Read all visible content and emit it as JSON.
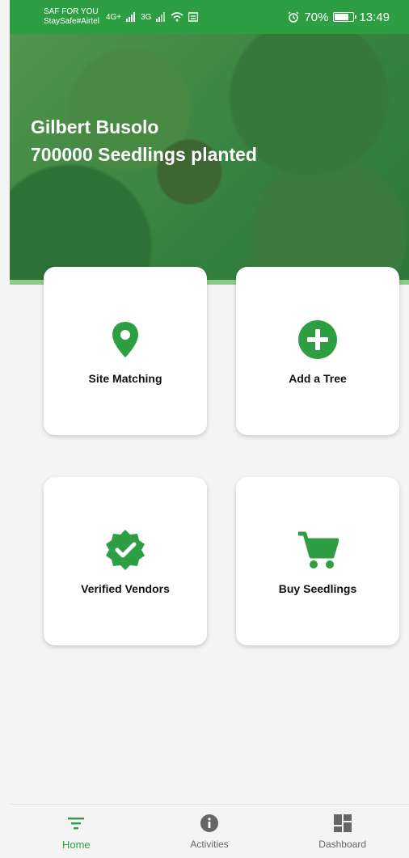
{
  "statusbar": {
    "carrier_line1": "SAF FOR YOU",
    "carrier_line2": "StaySafe#Airtel",
    "net1": "4G+",
    "net2": "3G",
    "battery": "70%",
    "time": "13:49"
  },
  "hero": {
    "name": "Gilbert Busolo",
    "stat": "700000 Seedlings planted"
  },
  "cards": [
    {
      "label": "Site Matching",
      "icon": "location-pin-icon"
    },
    {
      "label": "Add a Tree",
      "icon": "plus-circle-icon"
    },
    {
      "label": "Verified Vendors",
      "icon": "verified-badge-icon"
    },
    {
      "label": "Buy Seedlings",
      "icon": "shopping-cart-icon"
    }
  ],
  "nav": [
    {
      "label": "Home",
      "icon": "filter-lines-icon",
      "active": true
    },
    {
      "label": "Activities",
      "icon": "info-icon",
      "active": false
    },
    {
      "label": "Dashboard",
      "icon": "dashboard-grid-icon",
      "active": false
    }
  ],
  "colors": {
    "accent": "#2e9e43"
  }
}
